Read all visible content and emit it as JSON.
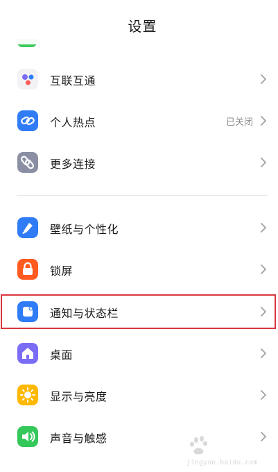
{
  "header": {
    "title": "设置"
  },
  "sections": [
    {
      "items": [
        {
          "id": "interconnect",
          "label": "互联互通",
          "icon": "interconnect-icon",
          "color": "#f2f2f4"
        },
        {
          "id": "hotspot",
          "label": "个人热点",
          "value": "已关闭",
          "icon": "hotspot-link-icon",
          "color": "#2f7cf6"
        },
        {
          "id": "more-connections",
          "label": "更多连接",
          "icon": "more-connections-link-icon",
          "color": "#8a8fa3"
        }
      ]
    },
    {
      "items": [
        {
          "id": "wallpaper",
          "label": "壁纸与个性化",
          "icon": "paintbrush-icon",
          "color": "#2f7cf6"
        },
        {
          "id": "lockscreen",
          "label": "锁屏",
          "icon": "lock-icon",
          "color": "#ff5a1f"
        },
        {
          "id": "notifications",
          "label": "通知与状态栏",
          "icon": "notification-icon",
          "color": "#2f7cf6"
        },
        {
          "id": "desktop",
          "label": "桌面",
          "icon": "home-icon",
          "color": "#7b6cf6"
        },
        {
          "id": "display",
          "label": "显示与亮度",
          "icon": "sun-icon",
          "color": "#ffb800"
        },
        {
          "id": "sound",
          "label": "声音与触感",
          "icon": "speaker-icon",
          "color": "#34c759"
        }
      ]
    }
  ],
  "watermark": {
    "text": "jingyan.baidu.com",
    "icon": "baidu-paw-icon"
  }
}
